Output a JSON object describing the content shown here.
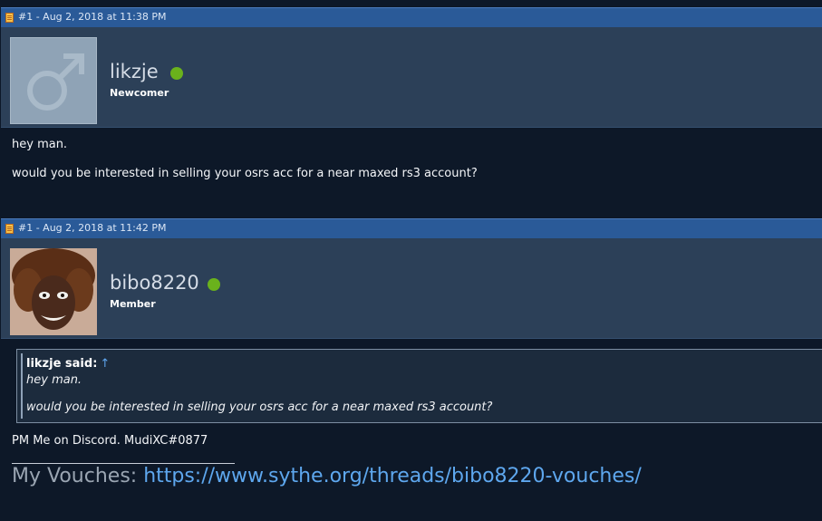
{
  "posts": [
    {
      "header": "#1 - Aug 2, 2018 at 11:38 PM",
      "username": "likzje",
      "user_title": "Newcomer",
      "avatar": "male-symbol-icon",
      "online": true,
      "body_lines": [
        "hey man.",
        "would you be interested in selling your osrs acc for a near maxed rs3 account?"
      ]
    },
    {
      "header": "#1 - Aug 2, 2018 at 11:42 PM",
      "username": "bibo8220",
      "user_title": "Member",
      "avatar": "photo-avatar",
      "online": true,
      "quote": {
        "author": "likzje said:",
        "arrow": "↑",
        "lines": [
          "hey man.",
          "would you be interested in selling your osrs acc for a near maxed rs3 account?"
        ]
      },
      "body_lines": [
        "PM Me on Discord. MudiXC#0877"
      ],
      "signature": {
        "label": "My Vouches: ",
        "link": "https://www.sythe.org/threads/bibo8220-vouches/"
      }
    }
  ],
  "colors": {
    "header_blue": "#2a5a98",
    "userbar": "#2c4058",
    "background": "#0d1828",
    "online_green": "#6ab21c",
    "link_blue": "#5ea7ee"
  }
}
